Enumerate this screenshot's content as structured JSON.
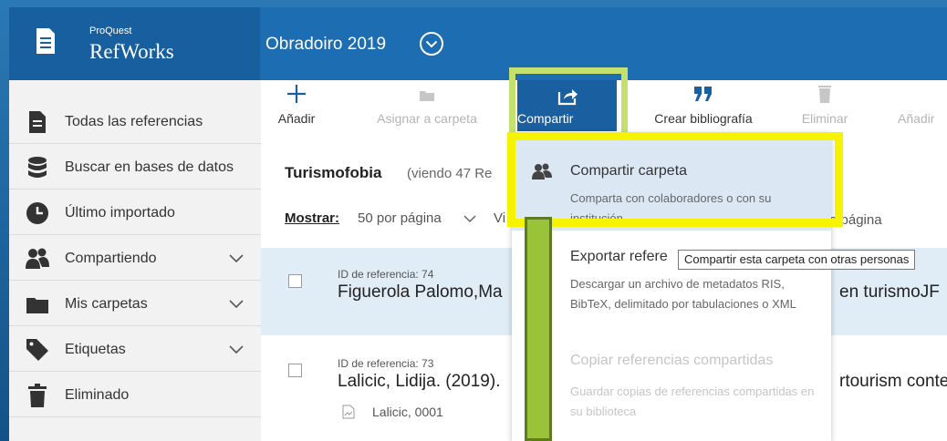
{
  "header": {
    "brand_sup": "ProQuest",
    "brand_name": "RefWorks",
    "project_name": "Obradoiro 2019"
  },
  "sidebar": {
    "items": [
      {
        "label": "Todas las referencias",
        "icon": "document-icon"
      },
      {
        "label": "Buscar en bases de datos",
        "icon": "database-icon"
      },
      {
        "label": "Último importado",
        "icon": "clock-icon"
      },
      {
        "label": "Compartiendo",
        "icon": "people-icon",
        "expandable": true
      },
      {
        "label": "Mis carpetas",
        "icon": "folder-icon",
        "expandable": true
      },
      {
        "label": "Etiquetas",
        "icon": "tag-icon",
        "expandable": true
      },
      {
        "label": "Eliminado",
        "icon": "trash-icon"
      }
    ]
  },
  "toolbar": {
    "add": "Añadir",
    "assign_folder": "Asignar a carpeta",
    "share": "Compartir",
    "create_bibliography": "Crear bibliografía",
    "delete": "Eliminar",
    "add_to_cut": "Añadir"
  },
  "folder": {
    "title": "Turismofobia",
    "count_cut": "(viendo 47 Re",
    "show_label": "Mostrar:",
    "per_page": "50 por página",
    "view_cut": "Vi",
    "per_page_tail": "a página"
  },
  "references": [
    {
      "id_label": "ID de referencia: 74",
      "title_cut": "Figuerola Palomo,Ma",
      "title_tail": "en turismoJF",
      "selected": true
    },
    {
      "id_label": "ID de referencia: 73",
      "title_cut": "Lalicic, Lidija. (2019).",
      "title_tail": "rtourism conte",
      "attachment": "Lalicic, 0001",
      "selected": false
    }
  ],
  "share_menu": {
    "items": [
      {
        "title": "Compartir carpeta",
        "description": "Comparta con colaboradores o con su institución",
        "active": true,
        "icon": "people-icon"
      },
      {
        "title_cut": "Exportar refere",
        "description": "Descargar un archivo de metadatos RIS, BibTeX, delimitado por tabulaciones o XML"
      },
      {
        "title": "Copiar referencias compartidas",
        "description": "Guardar copias de referencias compartidas en su biblioteca",
        "disabled": true
      }
    ]
  },
  "tooltip": "Compartir esta carpeta con otras personas",
  "colors": {
    "header_blue": "#1c6db2",
    "share_button": "#1a5f9f",
    "highlight_yellow": "#f6f300",
    "highlight_green": "#c5e06f",
    "annotation_bar": "#9bc33a"
  }
}
